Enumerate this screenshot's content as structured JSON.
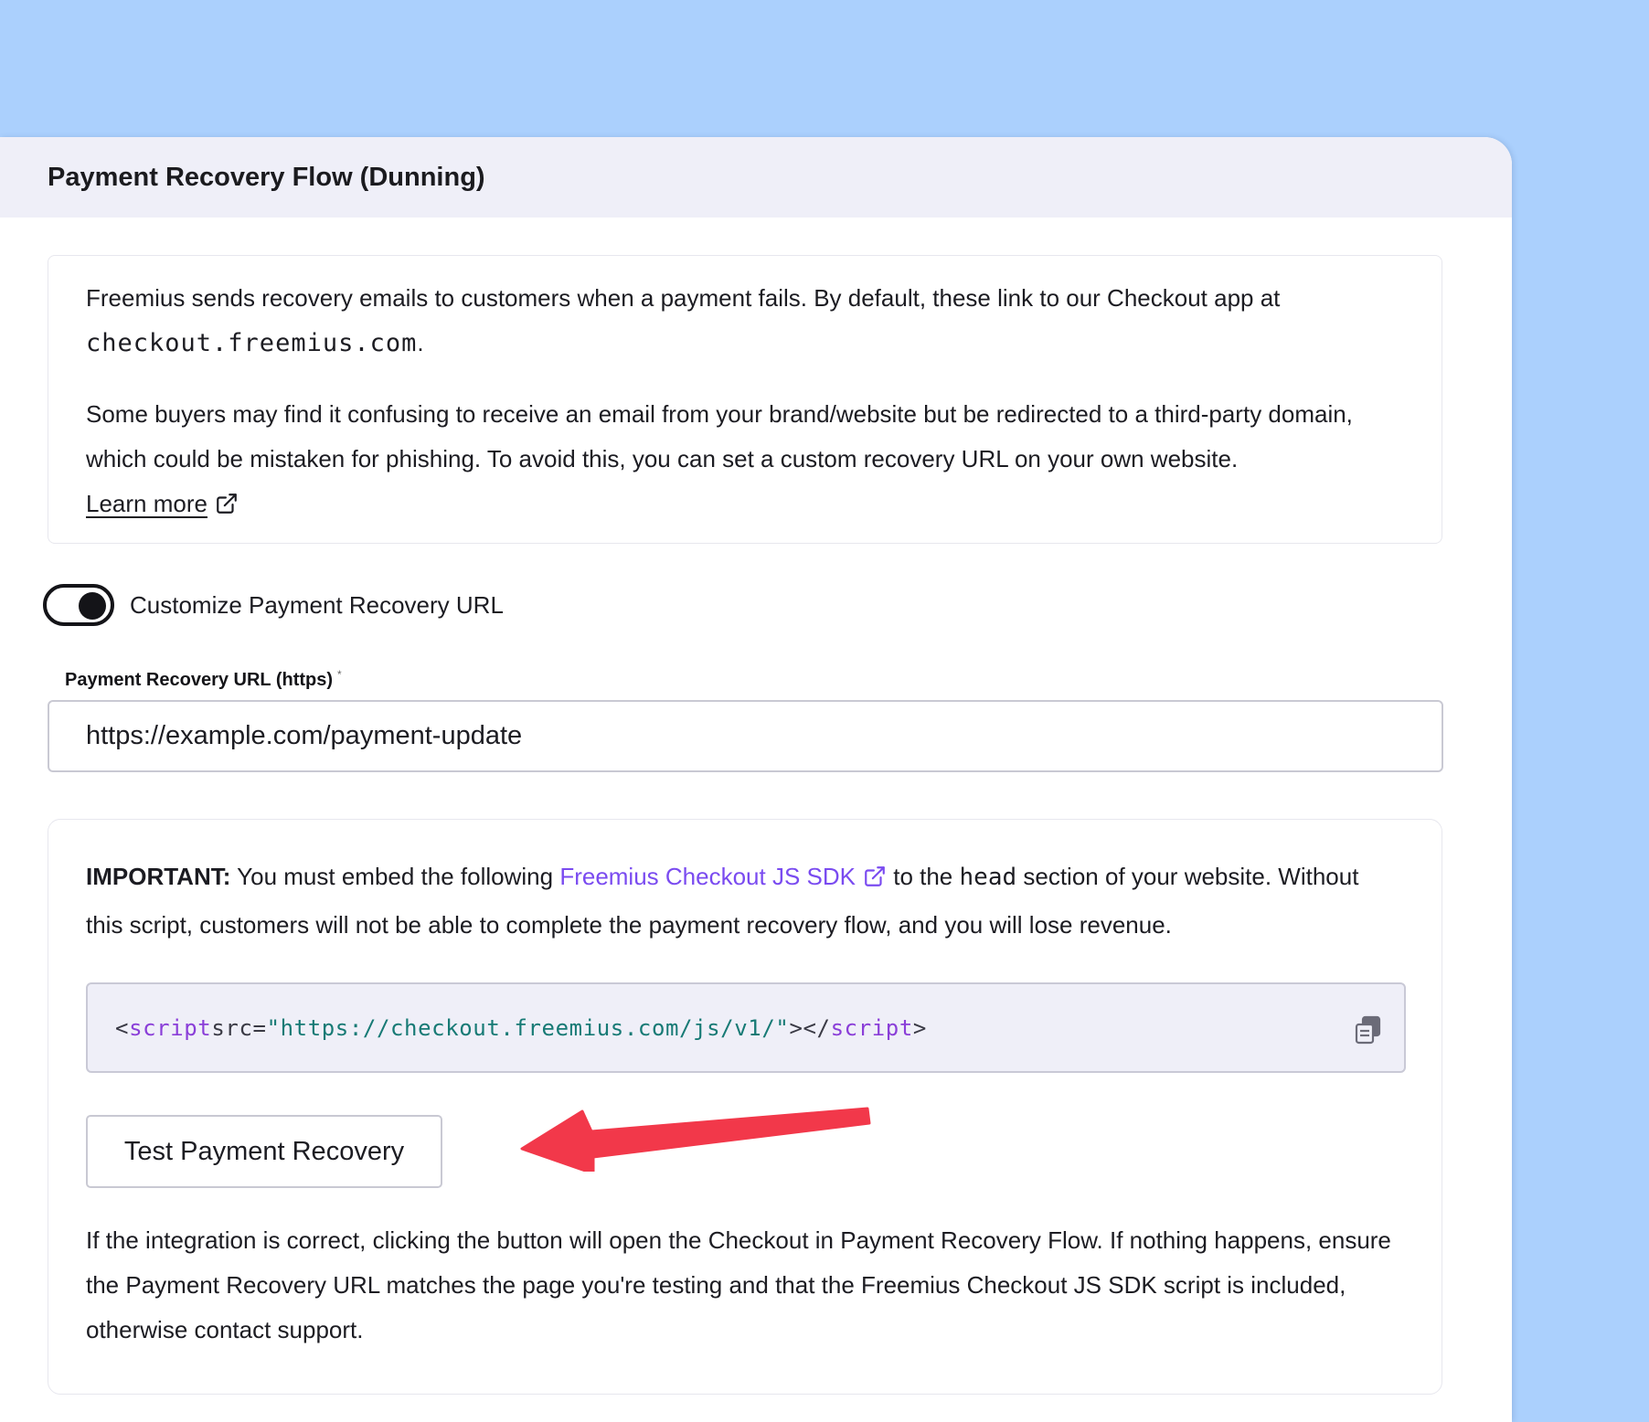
{
  "header": {
    "title": "Payment Recovery Flow (Dunning)"
  },
  "info": {
    "p1_text": "Freemius sends recovery emails to customers when a payment fails. By default, these link to our Checkout app at",
    "p1_domain": "checkout.freemius.com",
    "p1_end": ".",
    "p2_text": "Some buyers may find it confusing to receive an email from your brand/website but be redirected to a third-party domain, which could be mistaken for phishing. To avoid this, you can set a custom recovery URL on your own website.",
    "learn_more": "Learn more"
  },
  "toggle": {
    "label": "Customize Payment Recovery URL",
    "state": "on"
  },
  "url_field": {
    "label": "Payment Recovery URL (https)",
    "required_mark": "*",
    "value": "https://example.com/payment-update"
  },
  "important": {
    "strong": "IMPORTANT:",
    "text_before": "You must embed the following",
    "sdk_link": "Freemius Checkout JS SDK",
    "text_middle": "to the",
    "code_word": "head",
    "text_after": "section of your website. Without this script, customers will not be able to complete the payment recovery flow, and you will lose revenue."
  },
  "code": {
    "open_bracket": "<",
    "tag": "script",
    "attr": " src=",
    "value": "\"https://checkout.freemius.com/js/v1/\"",
    "mid": "></",
    "close_bracket": ">"
  },
  "test_button": {
    "label": "Test Payment Recovery"
  },
  "result": {
    "text": "If the integration is correct, clicking the button will open the Checkout in Payment Recovery Flow. If nothing happens, ensure the Payment Recovery URL matches the page you're testing and that the Freemius Checkout JS SDK script is included, otherwise contact support."
  },
  "colors": {
    "background": "#abd0fd",
    "header_bg": "#efeff8",
    "link_purple": "#7a4bf0",
    "arrow_red": "#f2384a"
  }
}
